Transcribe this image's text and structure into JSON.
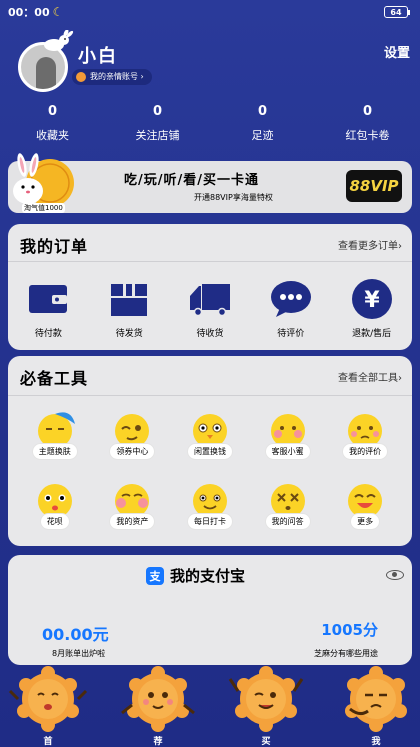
{
  "status": {
    "time": "00：00",
    "battery": "64",
    "moon_icon": "crescent-moon-icon"
  },
  "profile": {
    "name": "小白",
    "family_account": "我的亲情账号",
    "settings_label": "设置"
  },
  "stats": [
    {
      "value": "0",
      "label": "收藏夹"
    },
    {
      "value": "0",
      "label": "关注店铺"
    },
    {
      "value": "0",
      "label": "足迹"
    },
    {
      "value": "0",
      "label": "红包卡卷"
    }
  ],
  "vip": {
    "mascot_value": "淘气值1000",
    "title": "吃/玩/听/看/买一卡通",
    "subtitle": "开通88VIP享海量特权",
    "badge": "88VIP"
  },
  "orders": {
    "title": "我的订单",
    "more": "查看更多订单",
    "items": [
      {
        "label": "待付款",
        "icon": "wallet-icon"
      },
      {
        "label": "待发货",
        "icon": "package-icon"
      },
      {
        "label": "待收货",
        "icon": "truck-icon"
      },
      {
        "label": "待评价",
        "icon": "chat-bubble-icon"
      },
      {
        "label": "退款/售后",
        "icon": "refund-icon"
      }
    ]
  },
  "tools": {
    "title": "必备工具",
    "more": "查看全部工具",
    "items": [
      {
        "label": "主题换肤",
        "icon": "sleepy-face-icon"
      },
      {
        "label": "领券中心",
        "icon": "winking-face-icon"
      },
      {
        "label": "闲置换钱",
        "icon": "staring-face-icon"
      },
      {
        "label": "客服小蜜",
        "icon": "blushing-face-icon"
      },
      {
        "label": "我的评价",
        "icon": "worried-face-icon"
      },
      {
        "label": "花呗",
        "icon": "surprised-face-icon"
      },
      {
        "label": "我的资产",
        "icon": "shy-face-icon"
      },
      {
        "label": "每日打卡",
        "icon": "smiling-face-icon"
      },
      {
        "label": "我的问答",
        "icon": "dizzy-face-icon"
      },
      {
        "label": "更多",
        "icon": "grinning-face-icon"
      }
    ]
  },
  "alipay": {
    "title": "我的支付宝",
    "logo": "支",
    "balance": "00.00元",
    "balance_note": "8月账单出炉啦",
    "sesame": "1005分",
    "sesame_note": "芝麻分有哪些用途"
  },
  "tabs": [
    {
      "label": "首",
      "icon": "mooncake-mascot-icon"
    },
    {
      "label": "荐",
      "icon": "mooncake-mascot-icon"
    },
    {
      "label": "买",
      "icon": "mooncake-mascot-icon"
    },
    {
      "label": "我",
      "icon": "mooncake-mascot-icon"
    }
  ],
  "colors": {
    "background": "#23318d",
    "card": "#e8e8ea",
    "icon_navy": "#1f2c86",
    "alipay_blue": "#1677ff",
    "emoji_yellow": "#fbd326"
  }
}
